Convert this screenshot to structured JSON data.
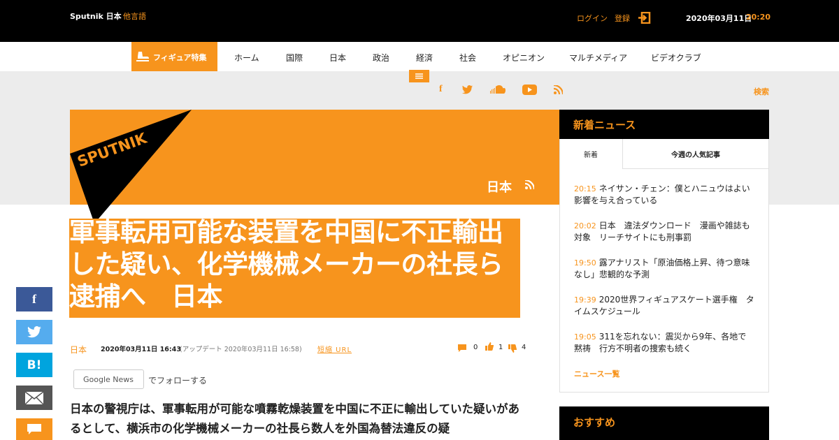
{
  "top": {
    "brand": "Sputnik 日本",
    "other_lang": "他言語",
    "login": "ログイン",
    "register": "登録",
    "date": "2020年03月11日",
    "time": "20:20"
  },
  "nav": {
    "special": "フィギュア特集",
    "items": [
      "ホーム",
      "国際",
      "日本",
      "政治",
      "経済",
      "社会",
      "オピニオン",
      "マルチメディア",
      "ビデオクラブ"
    ]
  },
  "search_label": "検索",
  "banner": {
    "logo": "SPUTNIK",
    "section": "日本"
  },
  "article": {
    "title": "軍事転用可能な装置を中国に不正輸出した疑い、化学機械メーカーの社長ら逮捕へ　日本",
    "category": "日本",
    "published": "2020年03月11日 16:43",
    "updated": "(アップデート 2020年03月11日 16:58)",
    "short_url": "短縮 URL",
    "comments": "0",
    "likes": "1",
    "dislikes": "4",
    "gnews_label": "Google News",
    "follow_text": "でフォローする",
    "lead": "日本の警視庁は、軍事転用が可能な噴霧乾燥装置を中国に不正に輸出していた疑いがあるとして、横浜市の化学機械メーカーの社長ら数人を外国為替法違反の疑"
  },
  "sidebar": {
    "title": "新着ニュース",
    "tab_new": "新着",
    "tab_popular": "今週の人気記事",
    "news": [
      {
        "time": "20:15",
        "text": "ネイサン・チェン：僕とハニュウはよい影響を与え合っている"
      },
      {
        "time": "20:02",
        "text": "日本　違法ダウンロード　漫画や雑誌も対象　リーチサイトにも刑事罰"
      },
      {
        "time": "19:50",
        "text": "露アナリスト「原油価格上昇、待つ意味なし」悲観的な予測"
      },
      {
        "time": "19:39",
        "text": "2020世界フィギュアスケート選手権　タイムスケジュール"
      },
      {
        "time": "19:05",
        "text": "311を忘れない：震災から9年、各地で黙祷　行方不明者の捜索も続く"
      }
    ],
    "all_news": "ニュース一覧",
    "recommend": "おすすめ"
  },
  "share": {
    "facebook": "f",
    "hatena": "B!"
  },
  "colors": {
    "accent": "#f7941d",
    "dark": "#000000",
    "gray": "#ececec"
  }
}
